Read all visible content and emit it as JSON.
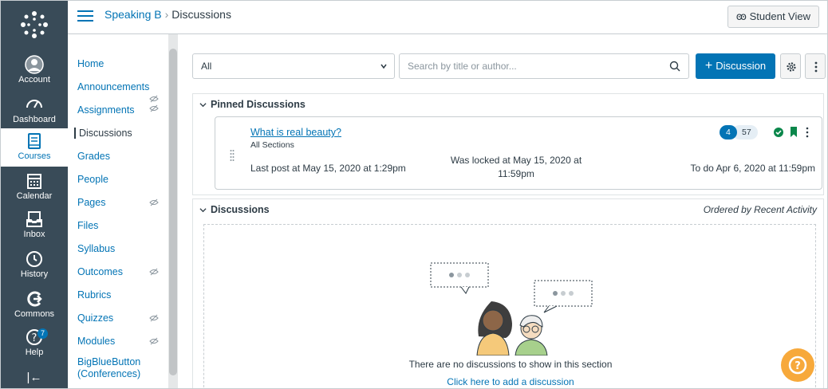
{
  "global_nav": {
    "items": [
      {
        "label": "Account",
        "icon": "account-icon"
      },
      {
        "label": "Dashboard",
        "icon": "dashboard-icon"
      },
      {
        "label": "Courses",
        "icon": "courses-icon"
      },
      {
        "label": "Calendar",
        "icon": "calendar-icon"
      },
      {
        "label": "Inbox",
        "icon": "inbox-icon"
      },
      {
        "label": "History",
        "icon": "history-icon"
      },
      {
        "label": "Commons",
        "icon": "commons-icon"
      },
      {
        "label": "Help",
        "icon": "help-icon",
        "badge": "7"
      }
    ],
    "active": "Courses",
    "collapse_glyph": "|←"
  },
  "header": {
    "course": "Speaking B",
    "separator": "›",
    "current": "Discussions",
    "student_view": "Student View",
    "student_view_glyph": "ꙭ"
  },
  "course_nav": {
    "items": [
      {
        "label": "Home",
        "hidden": false
      },
      {
        "label": "Announcements",
        "hidden": false
      },
      {
        "label": "Assignments",
        "hidden": true
      },
      {
        "label": "Discussions",
        "hidden": false,
        "active": true
      },
      {
        "label": "Grades",
        "hidden": false
      },
      {
        "label": "People",
        "hidden": false
      },
      {
        "label": "Pages",
        "hidden": true
      },
      {
        "label": "Files",
        "hidden": false
      },
      {
        "label": "Syllabus",
        "hidden": false
      },
      {
        "label": "Outcomes",
        "hidden": true
      },
      {
        "label": "Rubrics",
        "hidden": false
      },
      {
        "label": "Quizzes",
        "hidden": true
      },
      {
        "label": "Modules",
        "hidden": true
      },
      {
        "label": "BigBlueButton",
        "label2": "(Conferences)",
        "hidden": false
      }
    ]
  },
  "toolbar": {
    "filter_value": "All",
    "search_placeholder": "Search by title or author...",
    "add_button": "Discussion",
    "add_glyph": "+"
  },
  "pinned": {
    "heading": "Pinned Discussions",
    "card": {
      "title": "What is real beauty?",
      "sections": "All Sections",
      "last_post": "Last post at May 15, 2020 at 1:29pm",
      "locked_line1": "Was locked at May 15, 2020 at",
      "locked_line2": "11:59pm",
      "todo": "To do Apr 6, 2020 at 11:59pm",
      "unread": "4",
      "total": "57"
    }
  },
  "discussions": {
    "heading": "Discussions",
    "ordered": "Ordered by Recent Activity",
    "empty_text": "There are no discussions to show in this section",
    "empty_link": "Click here to add a discussion"
  },
  "colors": {
    "nav_bg": "#394b58",
    "brand_blue": "#0374b5",
    "success_green": "#0b874b",
    "help_orange": "#f7a93b"
  }
}
